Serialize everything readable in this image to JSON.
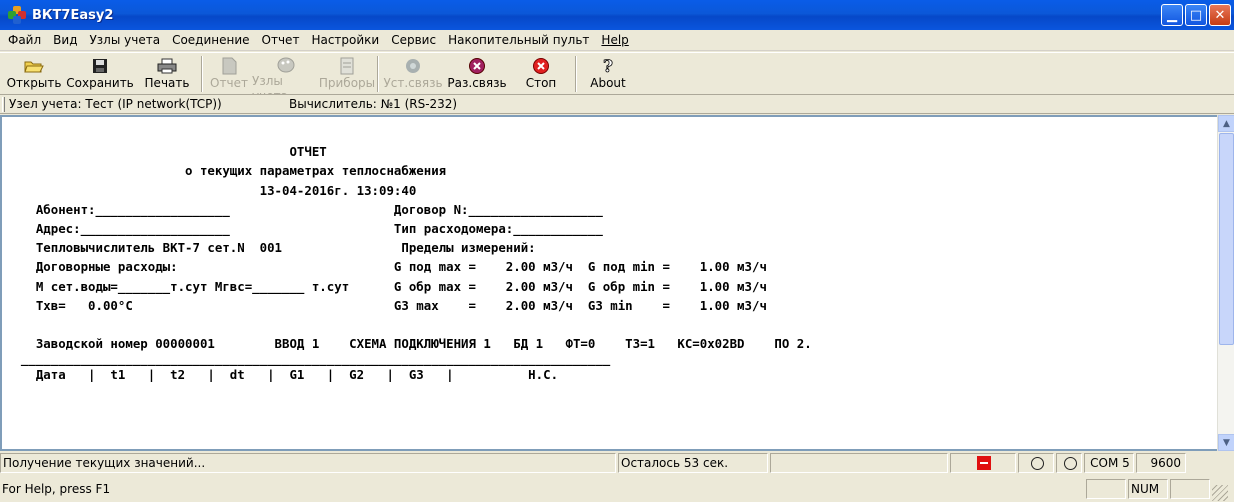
{
  "window": {
    "title": "ВКТ7Easy2"
  },
  "menu": [
    "Файл",
    "Вид",
    "Узлы учета",
    "Соединение",
    "Отчет",
    "Настройки",
    "Сервис",
    "Накопительный пульт",
    "Help"
  ],
  "toolbar": {
    "open": "Открыть",
    "save": "Сохранить",
    "print": "Печать",
    "report": "Отчет",
    "nodes": "Узлы учета",
    "devices": "Приборы",
    "connect": "Уст.связь",
    "disconnect": "Раз.связь",
    "stop": "Стоп",
    "about": "About"
  },
  "info": {
    "node": "Узел учета: Тест  (IP network(TCP))",
    "calc": "Вычислитель: №1 (RS-232)"
  },
  "report": {
    "lines": [
      "                                      ОТЧЕТ",
      "                        о текущих параметрах теплоснабжения",
      "                                  13-04-2016г. 13:09:40",
      "    Абонент:__________________                      Договор N:__________________",
      "    Адрес:____________________                      Тип расходомера:____________",
      "    Тепловычислитель ВКТ-7 сет.N  001                Пределы измерений:",
      "    Договорные расходы:                             G под max =    2.00 м3/ч  G под min =    1.00 м3/ч",
      "    М сет.воды=_______т.сут Мгвс=_______ т.сут      G обр max =    2.00 м3/ч  G обр min =    1.00 м3/ч",
      "    Тхв=   0.00°С                                   G3 max    =    2.00 м3/ч  G3 min    =    1.00 м3/ч",
      "",
      "    Заводской номер 00000001        ВВОД 1    СХЕМА ПОДКЛЮЧЕНИЯ 1   БД 1   ФТ=0    ТЗ=1   КС=0х02BD    ПО 2.",
      "  _______________________________________________________________________________",
      "    Дата   |  t1   |  t2   |  dt   |  G1   |  G2   |  G3   |          Н.С."
    ]
  },
  "status": {
    "progress": "Получение текущих значений...",
    "remaining": "Осталось 53 сек.",
    "port": "COM 5",
    "baud": "9600",
    "help": "For Help, press F1",
    "num": "NUM"
  }
}
